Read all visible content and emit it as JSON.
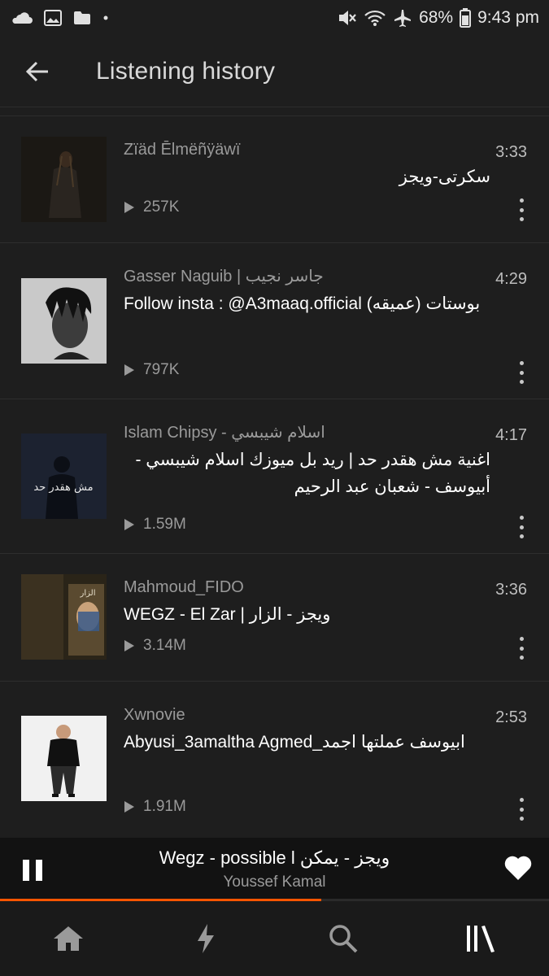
{
  "status_bar": {
    "battery": "68%",
    "time": "9:43 pm",
    "icons": [
      "soundcloud-icon",
      "image-icon",
      "folder-icon",
      "dot-icon",
      "mute-icon",
      "wifi-icon",
      "airplane-icon",
      "battery-icon"
    ]
  },
  "header": {
    "title": "Listening history",
    "back_icon": "arrow-left-icon"
  },
  "tracks": [
    {
      "artist": "Zïäd Ēlmëñÿäwï",
      "title": "سكرتى-ويجز",
      "plays": "257K",
      "duration": "3:33"
    },
    {
      "artist": "Gasser Naguib | جاسر نجيب",
      "title": "Follow insta : @A3maaq.official  بوستات (عميقه)",
      "plays": "797K",
      "duration": "4:29"
    },
    {
      "artist": "Islam Chipsy - اسلام شيبسي",
      "title": "اغنية مش هقدر حد | ريد بل ميوزك  اسلام شيبسي - أبيوسف - شعبان عبد الرحيم",
      "plays": "1.59M",
      "duration": "4:17"
    },
    {
      "artist": "Mahmoud_FIDO",
      "title": "WEGZ - El Zar | ويجز - الزار",
      "plays": "3.14M",
      "duration": "3:36"
    },
    {
      "artist": "Xwnovie",
      "title": "Abyusi_3amaltha Agmed_ابيوسف عملتها اجمد",
      "plays": "1.91M",
      "duration": "2:53"
    }
  ],
  "artwork_text": {
    "track3": "مش هقدر حد",
    "track4": "الزار"
  },
  "now_playing": {
    "title": "Wegz - possible l ويجز - يمكن",
    "artist": "Youssef Kamal",
    "progress": 0.585,
    "liked": true
  },
  "bottom_nav": [
    {
      "name": "home",
      "icon": "home-icon"
    },
    {
      "name": "stream",
      "icon": "lightning-icon"
    },
    {
      "name": "search",
      "icon": "search-icon"
    },
    {
      "name": "library",
      "icon": "library-icon",
      "active": true
    }
  ],
  "colors": {
    "background": "#1e1e1e",
    "accent": "#ff5500",
    "text_secondary": "#9a9a9a"
  }
}
